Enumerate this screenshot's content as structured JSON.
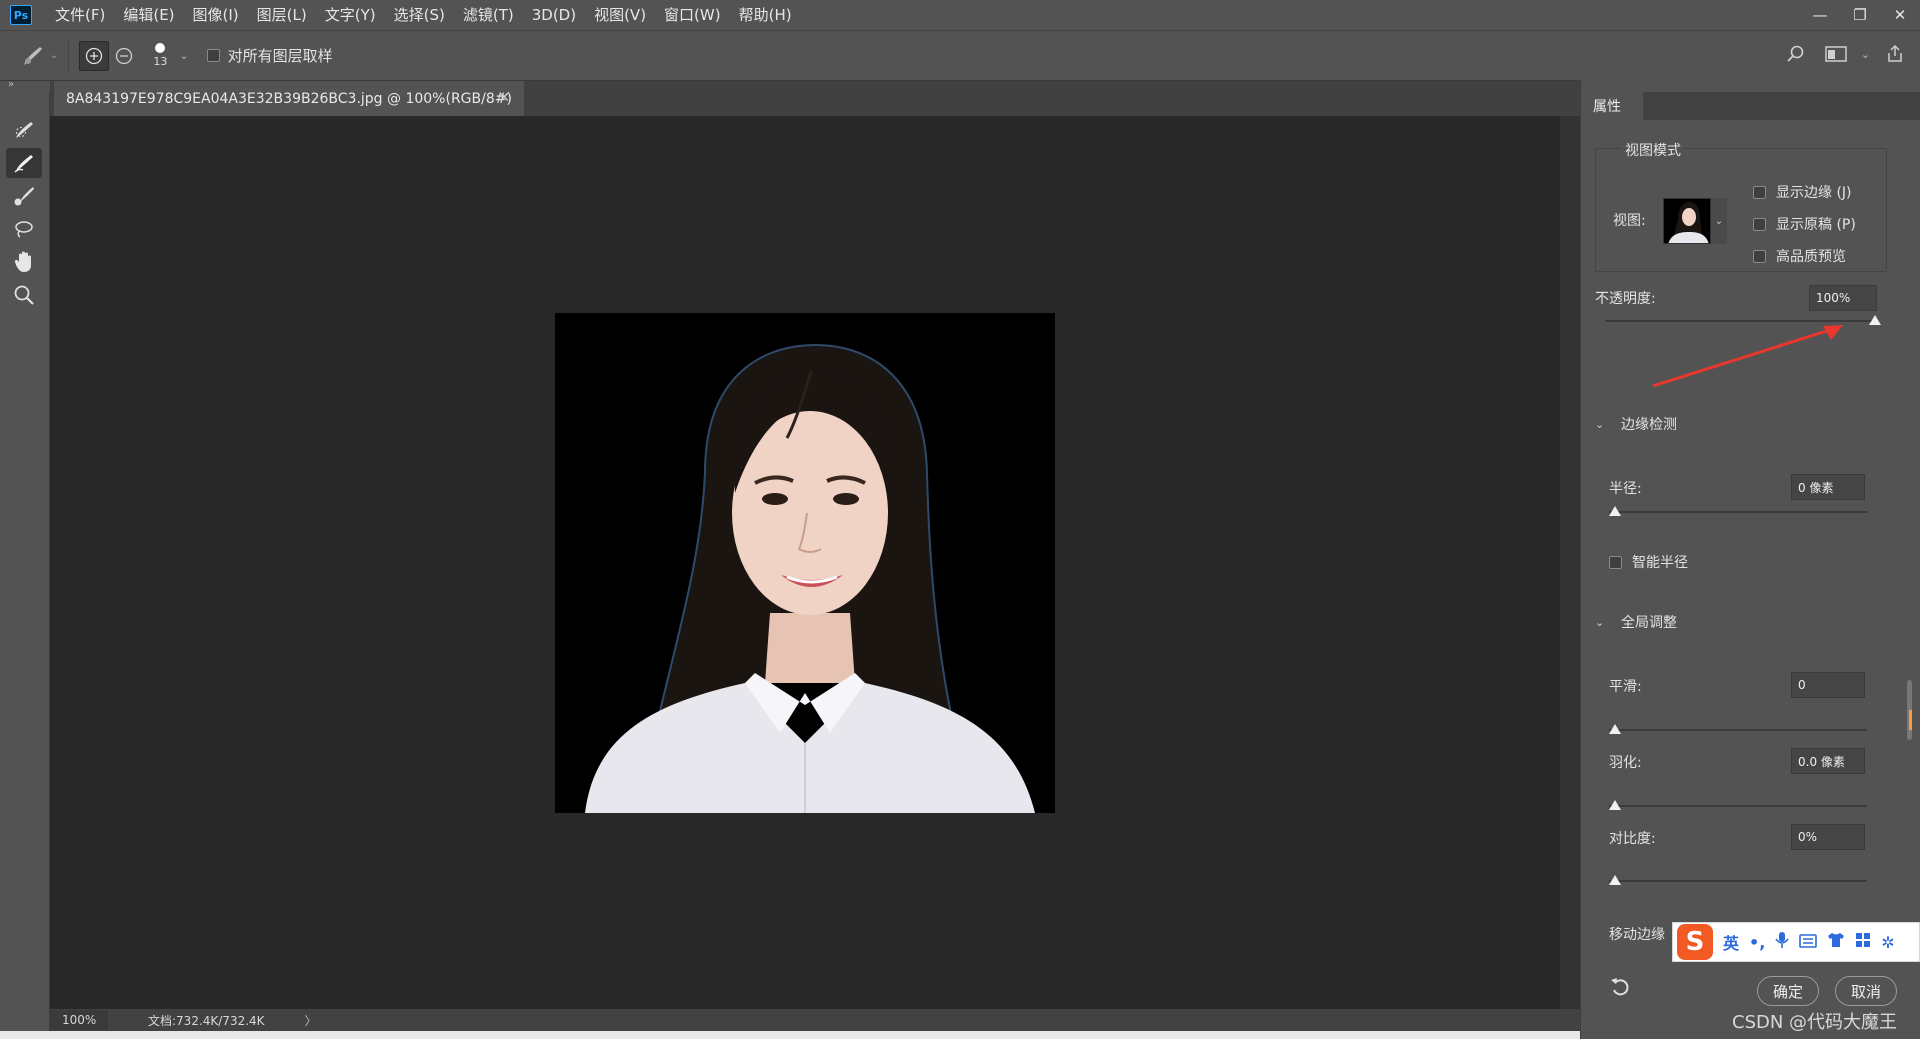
{
  "app": {
    "logo_text": "Ps"
  },
  "menu": [
    "文件(F)",
    "编辑(E)",
    "图像(I)",
    "图层(L)",
    "文字(Y)",
    "选择(S)",
    "滤镜(T)",
    "3D(D)",
    "视图(V)",
    "窗口(W)",
    "帮助(H)"
  ],
  "options": {
    "brush_size": "13",
    "sample_all_layers": "对所有图层取样"
  },
  "document": {
    "tab_title": "8A843197E978C9EA04A3E32B39B26BC3.jpg @ 100%(RGB/8#)"
  },
  "status": {
    "zoom": "100%",
    "doc_info": "文档:732.4K/732.4K",
    "arrow": "〉"
  },
  "panel": {
    "tab": "属性",
    "view_mode": {
      "title": "视图模式",
      "view_label": "视图:",
      "show_edge": "显示边缘 (J)",
      "show_original": "显示原稿 (P)",
      "high_quality": "高品质预览"
    },
    "opacity": {
      "label": "不透明度:",
      "value": "100%",
      "level": 1.0
    },
    "edge_detection": {
      "title": "边缘检测",
      "radius_label": "半径:",
      "radius_value": "0 像素",
      "smart_radius": "智能半径"
    },
    "global_refine": {
      "title": "全局调整",
      "smooth_label": "平滑:",
      "smooth_value": "0",
      "feather_label": "羽化:",
      "feather_value": "0.0 像素",
      "contrast_label": "对比度:",
      "contrast_value": "0%",
      "shift_edge_label": "移动边缘"
    },
    "ok": "确定",
    "cancel": "取消"
  },
  "ime": {
    "logo": "S",
    "lang": "英"
  },
  "watermark": "CSDN @代码大魔王",
  "colors": {
    "accent_arrow": "#e8372c",
    "panel_bg": "#535353",
    "canvas_bg": "#282828"
  }
}
